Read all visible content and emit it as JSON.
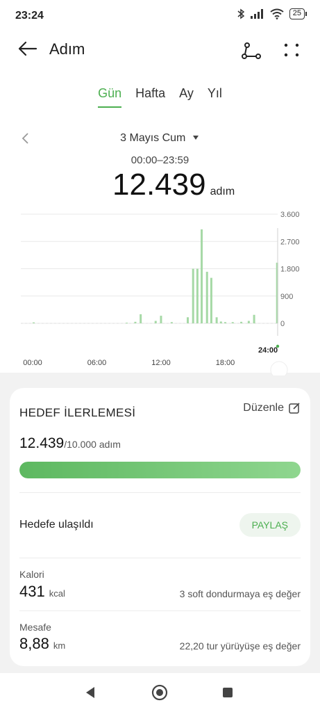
{
  "status": {
    "time": "23:24",
    "battery": "25"
  },
  "header": {
    "title": "Adım"
  },
  "tabs": [
    {
      "label": "Gün"
    },
    {
      "label": "Hafta"
    },
    {
      "label": "Ay"
    },
    {
      "label": "Yıl"
    }
  ],
  "active_tab": "Gün",
  "summary": {
    "date": "3 Mayıs Cum",
    "range": "00:00–23:59",
    "steps": "12.439",
    "unit": "adım"
  },
  "chart_data": {
    "type": "bar",
    "x_tick_labels": [
      "00:00",
      "06:00",
      "12:00",
      "18:00",
      "24:00"
    ],
    "y_tick_labels": [
      "3.600",
      "2.700",
      "1.800",
      "900",
      "0"
    ],
    "ylim": [
      0,
      3600
    ],
    "grid": true,
    "bars": [
      {
        "x": 1.2,
        "y": 30
      },
      {
        "x": 9.9,
        "y": 20
      },
      {
        "x": 10.7,
        "y": 50
      },
      {
        "x": 11.2,
        "y": 300
      },
      {
        "x": 12.6,
        "y": 80
      },
      {
        "x": 13.1,
        "y": 250
      },
      {
        "x": 14.1,
        "y": 40
      },
      {
        "x": 15.6,
        "y": 200
      },
      {
        "x": 16.1,
        "y": 1800
      },
      {
        "x": 16.5,
        "y": 1800
      },
      {
        "x": 16.9,
        "y": 3100
      },
      {
        "x": 17.4,
        "y": 1700
      },
      {
        "x": 17.8,
        "y": 1500
      },
      {
        "x": 18.3,
        "y": 200
      },
      {
        "x": 18.7,
        "y": 60
      },
      {
        "x": 19.1,
        "y": 40
      },
      {
        "x": 19.8,
        "y": 40
      },
      {
        "x": 20.6,
        "y": 50
      },
      {
        "x": 21.3,
        "y": 80
      },
      {
        "x": 21.8,
        "y": 280
      },
      {
        "x": 23.95,
        "y": 2000
      }
    ],
    "color": "#a6d9a6",
    "marker_label": "24:00"
  },
  "goal": {
    "title": "HEDEF İLERLEMESİ",
    "edit_label": "Düzenle",
    "current": "12.439",
    "target": "/10.000 adım",
    "progress": 1.0,
    "status": "Hedefe ulaşıldı",
    "share_label": "PAYLAŞ"
  },
  "calories": {
    "label": "Kalori",
    "value": "431",
    "unit": "kcal",
    "equiv": "3 soft dondurmaya eş değer"
  },
  "distance": {
    "label": "Mesafe",
    "value": "8,88",
    "unit": "km",
    "equiv": "22,20 tur yürüyüşe eş değer"
  },
  "colors": {
    "accent": "#4caf50",
    "bar": "#a6d9a6",
    "bg": "#f2f2f2"
  }
}
